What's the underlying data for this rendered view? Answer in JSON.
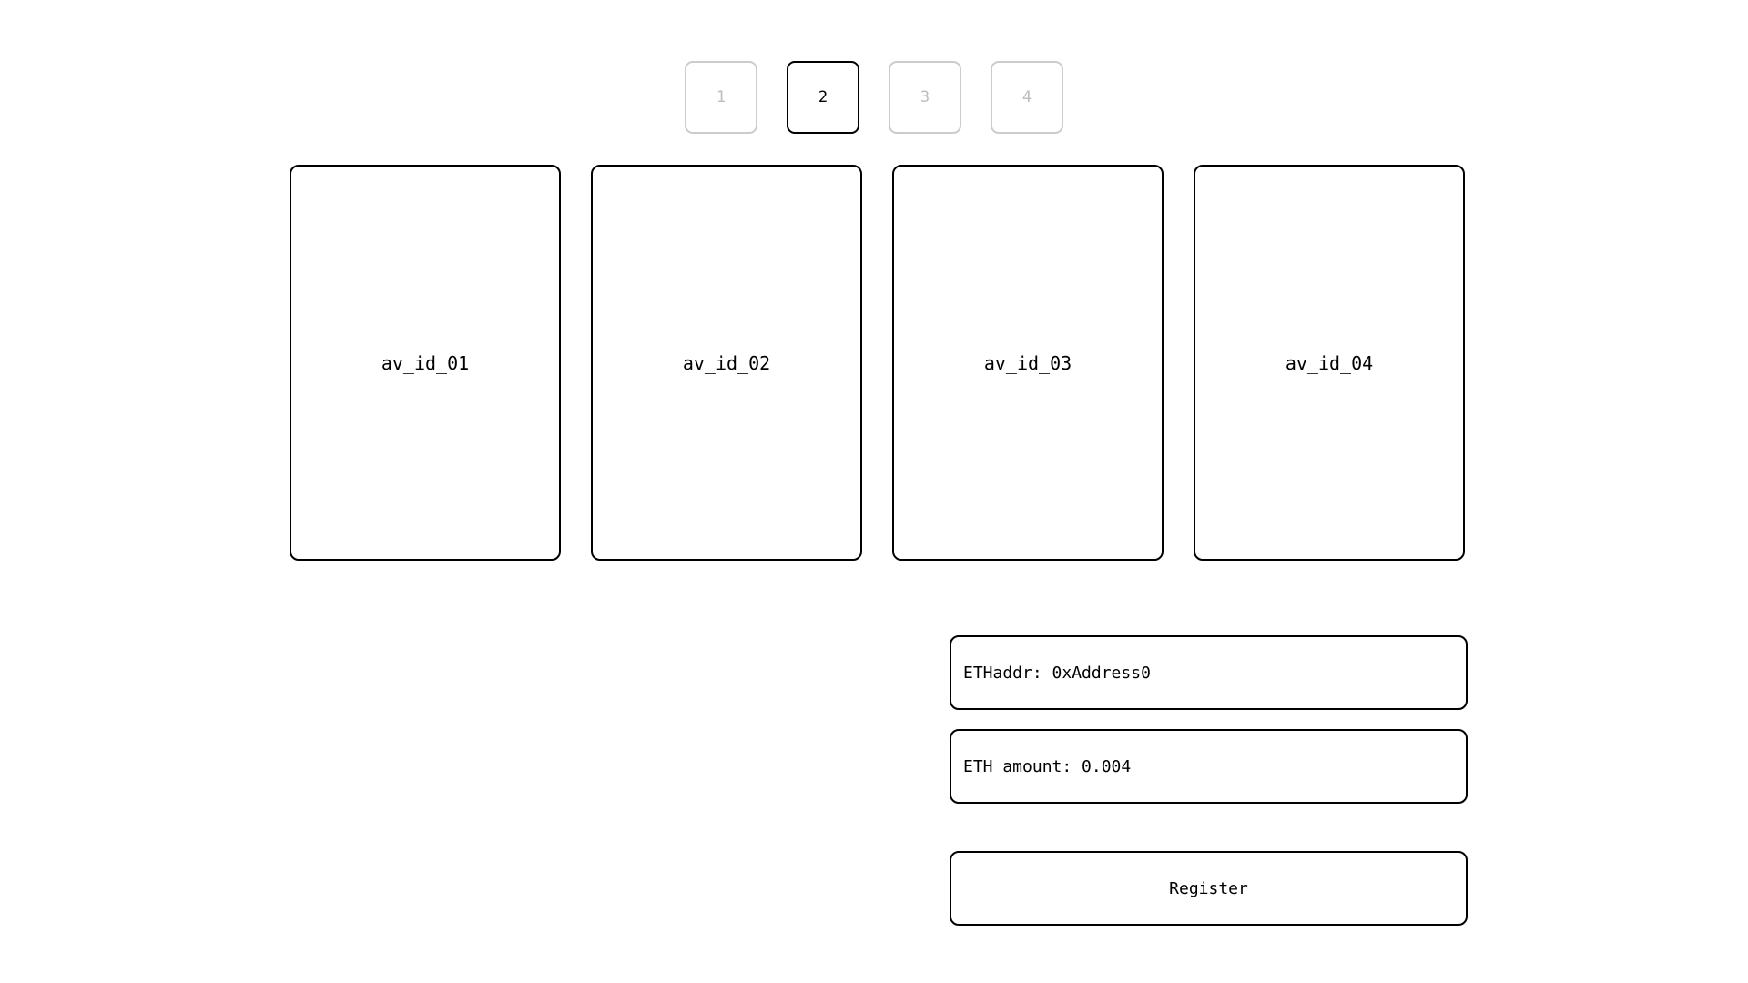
{
  "steps": [
    {
      "label": "1",
      "active": false
    },
    {
      "label": "2",
      "active": true
    },
    {
      "label": "3",
      "active": false
    },
    {
      "label": "4",
      "active": false
    }
  ],
  "avatars": [
    {
      "label": "av_id_01"
    },
    {
      "label": "av_id_02"
    },
    {
      "label": "av_id_03"
    },
    {
      "label": "av_id_04"
    }
  ],
  "form": {
    "eth_addr_text": "ETHaddr: 0xAddress0",
    "eth_amount_text": "ETH amount: 0.004",
    "register_label": "Register"
  },
  "colors": {
    "active_border": "#000000",
    "inactive_border": "#cccccc",
    "inactive_text": "#bdbdbd"
  }
}
